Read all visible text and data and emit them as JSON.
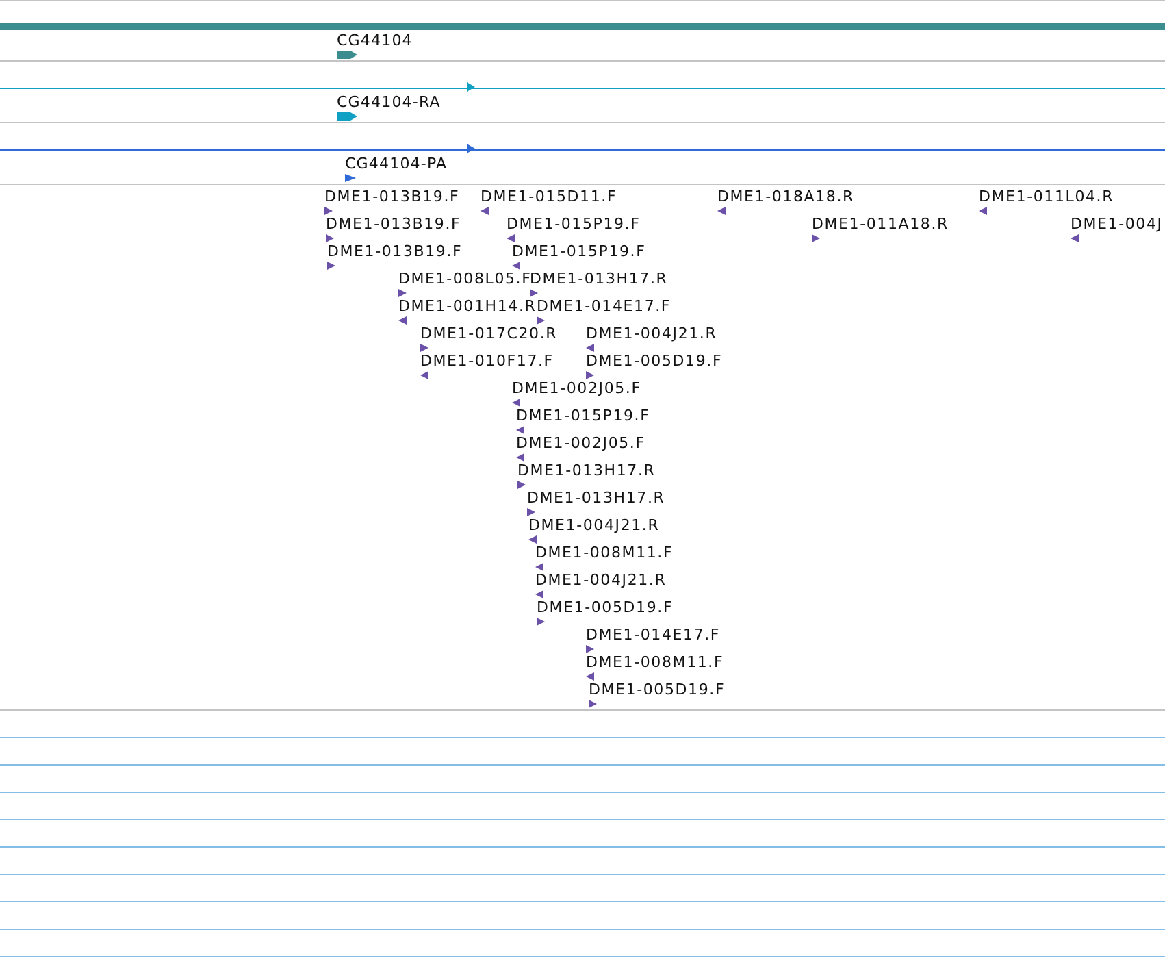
{
  "tracks": [
    {
      "kind": "gene",
      "label": "CG44104",
      "color": "#3c8d8f"
    },
    {
      "kind": "transcript",
      "label": "CG44104-RA",
      "color": "#0fa0c4"
    },
    {
      "kind": "transcript",
      "label": "CG44104-PA",
      "color": "#2f6ad6"
    }
  ],
  "features": [
    {
      "label": "DME1-013B19.F",
      "reverse_strand": false
    },
    {
      "label": "DME1-015D11.F",
      "reverse_strand": true
    },
    {
      "label": "DME1-018A18.R",
      "reverse_strand": true
    },
    {
      "label": "DME1-011L04.R",
      "reverse_strand": true
    },
    {
      "label": "DME1-013B19.F",
      "reverse_strand": false
    },
    {
      "label": "DME1-015P19.F",
      "reverse_strand": true
    },
    {
      "label": "DME1-011A18.R",
      "reverse_strand": false
    },
    {
      "label": "DME1-004J",
      "reverse_strand": true
    },
    {
      "label": "DME1-013B19.F",
      "reverse_strand": false
    },
    {
      "label": "DME1-015P19.F",
      "reverse_strand": true
    },
    {
      "label": "DME1-008L05.F",
      "reverse_strand": false
    },
    {
      "label": "DME1-013H17.R",
      "reverse_strand": false
    },
    {
      "label": "DME1-001H14.R",
      "reverse_strand": true
    },
    {
      "label": "DME1-014E17.F",
      "reverse_strand": false
    },
    {
      "label": "DME1-017C20.R",
      "reverse_strand": false
    },
    {
      "label": "DME1-004J21.R",
      "reverse_strand": true
    },
    {
      "label": "DME1-010F17.F",
      "reverse_strand": true
    },
    {
      "label": "DME1-005D19.F",
      "reverse_strand": false
    },
    {
      "label": "DME1-002J05.F",
      "reverse_strand": true
    },
    {
      "label": "DME1-015P19.F",
      "reverse_strand": true
    },
    {
      "label": "DME1-002J05.F",
      "reverse_strand": true
    },
    {
      "label": "DME1-013H17.R",
      "reverse_strand": false
    },
    {
      "label": "DME1-013H17.R",
      "reverse_strand": false
    },
    {
      "label": "DME1-004J21.R",
      "reverse_strand": true
    },
    {
      "label": "DME1-008M11.F",
      "reverse_strand": true
    },
    {
      "label": "DME1-004J21.R",
      "reverse_strand": true
    },
    {
      "label": "DME1-005D19.F",
      "reverse_strand": false
    },
    {
      "label": "DME1-014E17.F",
      "reverse_strand": false
    },
    {
      "label": "DME1-008M11.F",
      "reverse_strand": true
    },
    {
      "label": "DME1-005D19.F",
      "reverse_strand": false
    }
  ]
}
